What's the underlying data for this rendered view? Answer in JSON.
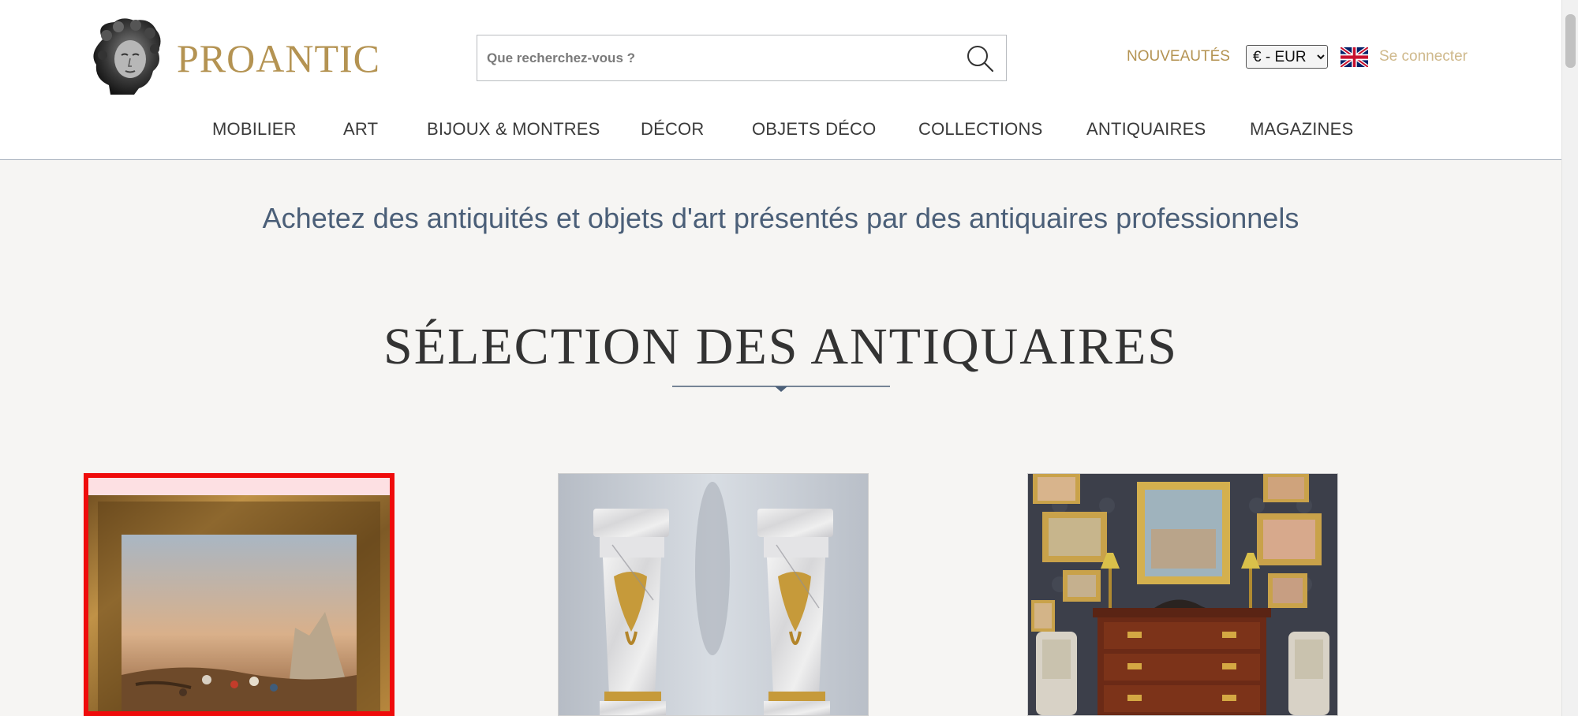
{
  "brand": {
    "name": "PROANTIC"
  },
  "search": {
    "placeholder": "Que recherchez-vous ?"
  },
  "header": {
    "new_label": "NOUVEAUTÉS",
    "currency": {
      "selected": "€ - EUR"
    },
    "language_flag": "uk-flag-icon",
    "login_label": "Se connecter"
  },
  "nav": {
    "items": [
      {
        "label": "MOBILIER"
      },
      {
        "label": "ART"
      },
      {
        "label": "BIJOUX & MONTRES"
      },
      {
        "label": "DÉCOR"
      },
      {
        "label": "OBJETS DÉCO"
      },
      {
        "label": "COLLECTIONS"
      },
      {
        "label": "ANTIQUAIRES"
      },
      {
        "label": "MAGAZINES"
      }
    ]
  },
  "main": {
    "tagline": "Achetez des antiquités et objets d'art présentés par des antiquaires professionnels",
    "section_title": "SÉLECTION DES ANTIQUAIRES"
  },
  "products": [
    {
      "image": "framed-landscape-painting"
    },
    {
      "image": "pair-of-marble-pedestals"
    },
    {
      "image": "antique-dealer-showroom"
    }
  ],
  "colors": {
    "brand_gold": "#b49352",
    "tagline_blue": "#4b5f78",
    "selection_red": "#ef0b0b",
    "page_bg": "#f6f5f3"
  }
}
